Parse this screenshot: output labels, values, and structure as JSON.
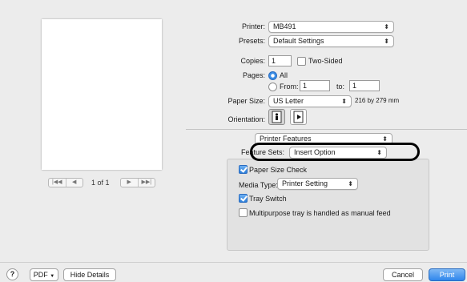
{
  "printer": {
    "label": "Printer:",
    "value": "MB491"
  },
  "presets": {
    "label": "Presets:",
    "value": "Default Settings"
  },
  "copies": {
    "label": "Copies:",
    "value": "1",
    "two_sided": "Two-Sided"
  },
  "pages": {
    "label": "Pages:",
    "all": "All",
    "from": "From:",
    "from_value": "1",
    "to": "to:",
    "to_value": "1"
  },
  "paper_size": {
    "label": "Paper Size:",
    "value": "US Letter",
    "dimensions": "216 by 279 mm"
  },
  "orientation": {
    "label": "Orientation:"
  },
  "section_popup": {
    "value": "Printer Features"
  },
  "feature_sets": {
    "label": "Feature Sets:",
    "value": "Insert Option"
  },
  "options": {
    "paper_size_check": "Paper Size Check",
    "media_type_label": "Media Type:",
    "media_type_value": "Printer Setting",
    "tray_switch": "Tray Switch",
    "multipurpose": "Multipurpose tray is handled as manual feed"
  },
  "preview": {
    "page_indicator": "1 of 1"
  },
  "footer": {
    "help": "?",
    "pdf": "PDF",
    "hide_details": "Hide Details",
    "cancel": "Cancel",
    "print": "Print"
  },
  "colors": {
    "accent": "#2f86ec",
    "highlight_ring": "#000000"
  },
  "icons": [
    "first-page-icon",
    "prev-page-icon",
    "next-page-icon",
    "last-page-icon",
    "portrait-icon",
    "landscape-icon"
  ]
}
